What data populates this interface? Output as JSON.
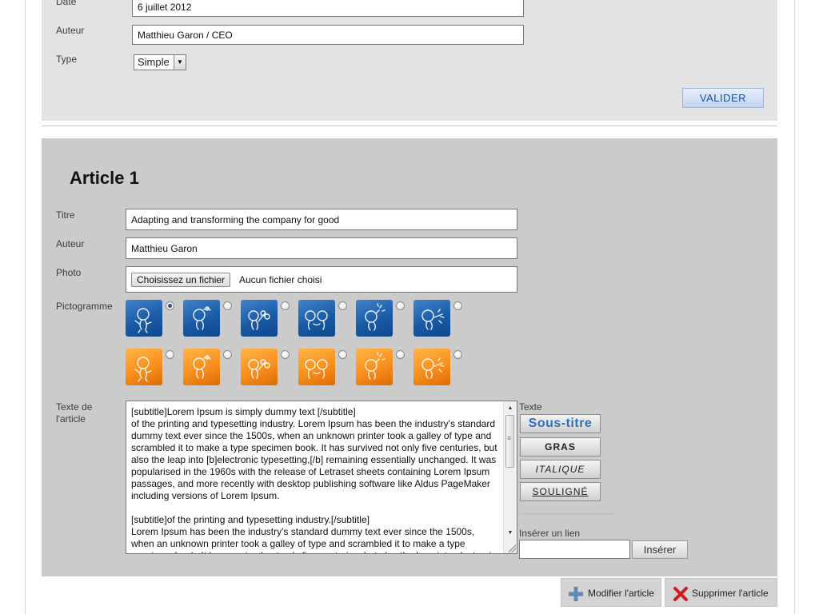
{
  "top_form": {
    "date_label": "Date",
    "date_value": "6 juillet 2012",
    "author_label": "Auteur",
    "author_value": "Matthieu Garon / CEO",
    "type_label": "Type",
    "type_value": "Simple",
    "submit_label": "VALIDER"
  },
  "article": {
    "heading": "Article 1",
    "title_label": "Titre",
    "title_value": "Adapting and transforming the company for good",
    "author_label": "Auteur",
    "author_value": "Matthieu Garon",
    "photo_label": "Photo",
    "file_button_label": "Choisissez un fichier",
    "file_status": "Aucun fichier choisi",
    "pictogram_label": "Pictogramme",
    "pictograms": [
      {
        "color": "blue",
        "selected": true,
        "icon": "character-waving-icon"
      },
      {
        "color": "blue",
        "selected": false,
        "icon": "character-thinking-icon"
      },
      {
        "color": "blue",
        "selected": false,
        "icon": "character-flowers-icon"
      },
      {
        "color": "blue",
        "selected": false,
        "icon": "characters-pair-icon"
      },
      {
        "color": "blue",
        "selected": false,
        "icon": "character-idea-icon"
      },
      {
        "color": "blue",
        "selected": false,
        "icon": "character-sparkle-icon"
      },
      {
        "color": "orange",
        "selected": false,
        "icon": "character-waving-icon"
      },
      {
        "color": "orange",
        "selected": false,
        "icon": "character-thinking-icon"
      },
      {
        "color": "orange",
        "selected": false,
        "icon": "character-flowers-icon"
      },
      {
        "color": "orange",
        "selected": false,
        "icon": "characters-pair-icon"
      },
      {
        "color": "orange",
        "selected": false,
        "icon": "character-idea-icon"
      },
      {
        "color": "orange",
        "selected": false,
        "icon": "character-sparkle-icon"
      }
    ],
    "text_label": "Texte de\nl'article",
    "text_value": "[subtitle]Lorem Ipsum is simply dummy text [/subtitle]\nof the printing and typesetting industry. Lorem Ipsum has been the industry's standard dummy text ever since the 1500s, when an unknown printer took a galley of type and scrambled it to make a type specimen book. It has survived not only five centuries, but also the leap into [b]electronic typesetting,[/b] remaining essentially unchanged. It was popularised in the 1960s with the release of Letraset sheets containing Lorem Ipsum passages, and more recently with desktop publishing software like Aldus PageMaker including versions of Lorem Ipsum.\n\n[subtitle]of the printing and typesetting industry.[/subtitle]\nLorem Ipsum has been the industry's standard dummy text ever since the 1500s, when an unknown printer took a galley of type and scrambled it to make a type specimen book. It has survived not only five centuries, but also the leap into electronic typesetting."
  },
  "formatting": {
    "heading": "Texte",
    "subtitle_label": "Sous-titre",
    "bold_label": "GRAS",
    "italic_label": "ITALIQUE",
    "underline_label": "SOULIGNÉ",
    "link_heading": "Insérer un lien",
    "link_value": "",
    "insert_label": "Insérer"
  },
  "actions": {
    "modify_label": "Modifier l'article",
    "delete_label": "Supprimer l'article"
  },
  "colors": {
    "accent_blue": "#2e6fb7",
    "picto_blue": "#1a5ba6",
    "picto_orange": "#f78f1c",
    "delete_red": "#d11a1a",
    "panel_gray": "#cbcbcb"
  }
}
